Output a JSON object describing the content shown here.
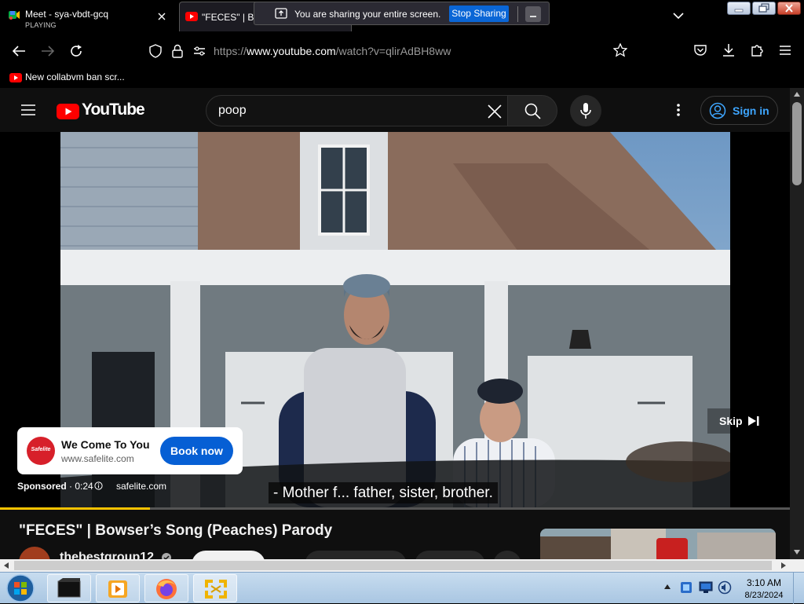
{
  "browser": {
    "tabs": [
      {
        "title": "Meet - sya-vbdt-gcq",
        "subtitle": "PLAYING"
      },
      {
        "title": "\"FECES\" | Bo"
      }
    ],
    "share_banner": {
      "text": "You are sharing your entire screen.",
      "stop_label": "Stop Sharing"
    },
    "url_prefix": "https://",
    "url_domain": "www.youtube.com",
    "url_path": "/watch?v=qlirAdBH8ww",
    "bookmark_label": "New collabvm ban scr..."
  },
  "youtube": {
    "logo_text": "YouTube",
    "search_query": "poop",
    "sign_in_label": "Sign in",
    "ad": {
      "logo_text": "Safelite",
      "title": "We Come To You",
      "site": "www.safelite.com",
      "cta": "Book now",
      "sponsored_label": "Sponsored",
      "time": "· 0:24",
      "domain": "safelite.com",
      "skip_label": "Skip"
    },
    "caption": "- Mother f... father, sister, brother.",
    "progress": 0.19,
    "video_title": "\"FECES\" | Bowser’s Song (Peaches) Parody",
    "channel_name": "thebestgroup12"
  },
  "taskbar": {
    "time": "3:10 AM",
    "date": "8/23/2024"
  },
  "colors": {
    "youtube_red": "#ff0000",
    "accent_blue": "#3ea6ff",
    "cta_blue": "#065fd4",
    "progress_yellow": "#fcc300",
    "safelite_red": "#d7202a"
  }
}
